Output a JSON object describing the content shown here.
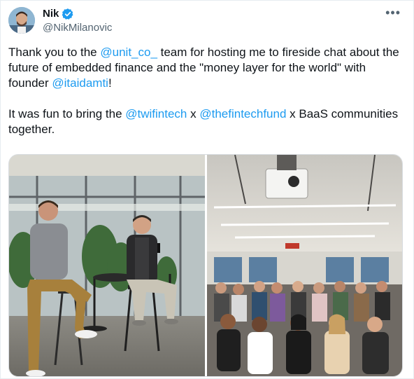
{
  "author": {
    "name": "Nik",
    "handle": "@NikMilanovic"
  },
  "tweet": {
    "para1": {
      "t1": "Thank you to the ",
      "m1": "@unit_co_",
      "t2": " team for hosting me to fireside chat about the future of embedded finance and the \"money layer for the world\" with founder ",
      "m2": "@itaidamti",
      "t3": "!"
    },
    "para2": {
      "t1": "It was fun to bring the ",
      "m1": "@twifintech",
      "t2": " x ",
      "m2": "@thefintechfund",
      "t3": " x BaaS communities together."
    }
  },
  "menu": {
    "more_label": "•••"
  },
  "colors": {
    "accent": "#1d9bf0",
    "text": "#0f1419",
    "muted": "#536471"
  },
  "icons": {
    "verified": "verified-badge-icon",
    "more": "more-options-icon"
  }
}
